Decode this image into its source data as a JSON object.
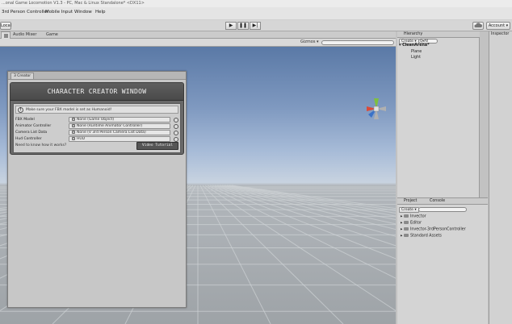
{
  "window": {
    "title": "...onal Game Locomotion V1.3 - PC, Mac & Linux Standalone* <DX11>"
  },
  "menu": [
    {
      "label": "3rd Person Controller"
    },
    {
      "label": "Mobile Input"
    },
    {
      "label": "Window"
    },
    {
      "label": "Help"
    }
  ],
  "toolbar": {
    "local_label": "Local",
    "play": "▶",
    "pause": "❚❚",
    "step": "▶|",
    "account_label": "Account ▾"
  },
  "tabs": {
    "scene_extra": "Audio Mixer",
    "game": "Game",
    "gizmos": "Gizmos ▾"
  },
  "dialog": {
    "tab": "3 Creator",
    "header": "CHARACTER CREATOR WINDOW",
    "info": "Make sure your FBX model is set as Humanoid!",
    "fields": [
      {
        "label": "FBX Model",
        "value": "None (Game Object)"
      },
      {
        "label": "Animator Controller",
        "value": "None (Runtime Animator Controller)"
      },
      {
        "label": "Camera List Data",
        "value": "None (V 3rd Person Camera List Data)"
      },
      {
        "label": "Hud Controller",
        "value": "HUD"
      }
    ],
    "note": "Need to know how it works?",
    "tutorial_button": "Video Tutorial"
  },
  "hierarchy": {
    "tab": "Hierarchy",
    "create": "Create ▾",
    "search_glyph": "Q▾All",
    "scene": "CleanArena*",
    "items": [
      "Plane",
      "Light"
    ]
  },
  "project": {
    "tab": "Project",
    "console_tab": "Console",
    "create": "Create ▾",
    "folders": [
      "Invector",
      "Editor",
      "Invector-3rdPersonController",
      "Standard Assets"
    ]
  },
  "inspector": {
    "tab": "Inspector"
  }
}
